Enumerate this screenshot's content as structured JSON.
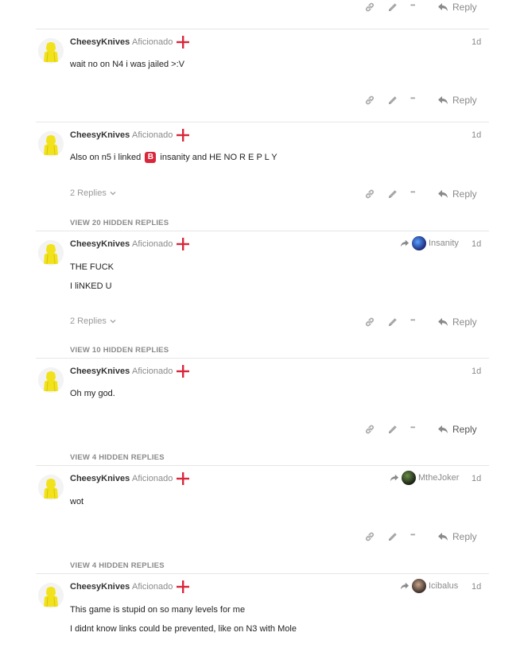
{
  "actions": {
    "reply_label": "Reply",
    "more_glyph": "•••"
  },
  "colors": {
    "flag_red": "#d9263a",
    "avatar_yellow": "#f2e21b",
    "badge_red": "#d9263a"
  },
  "comments": [
    {
      "username": "CheesyKnives",
      "role": "Aficionado",
      "time": "1d",
      "lines": [
        "wait no on N4 i was jailed >:V"
      ]
    },
    {
      "username": "CheesyKnives",
      "role": "Aficionado",
      "time": "1d",
      "line_parts": {
        "before": "Also on n5 i linked",
        "badge": "B",
        "after": "insanity and HE NO R E P L Y"
      },
      "replies_count": "2 Replies",
      "hidden_replies": "VIEW 20 HIDDEN REPLIES"
    },
    {
      "username": "CheesyKnives",
      "role": "Aficionado",
      "time": "1d",
      "reply_to": "Insanity",
      "lines": [
        "THE FUCK",
        "I liNKED U"
      ],
      "replies_count": "2 Replies",
      "hidden_replies": "VIEW 10 HIDDEN REPLIES"
    },
    {
      "username": "CheesyKnives",
      "role": "Aficionado",
      "time": "1d",
      "lines": [
        "Oh my god."
      ],
      "hidden_replies": "VIEW 4 HIDDEN REPLIES"
    },
    {
      "username": "CheesyKnives",
      "role": "Aficionado",
      "time": "1d",
      "reply_to": "MtheJoker",
      "lines": [
        "wot"
      ],
      "hidden_replies": "VIEW 4 HIDDEN REPLIES"
    },
    {
      "username": "CheesyKnives",
      "role": "Aficionado",
      "time": "1d",
      "reply_to": "Icibalus",
      "lines": [
        "This game is stupid on so many levels for me",
        "I didnt know links could be prevented, like on N3 with Mole"
      ]
    }
  ]
}
